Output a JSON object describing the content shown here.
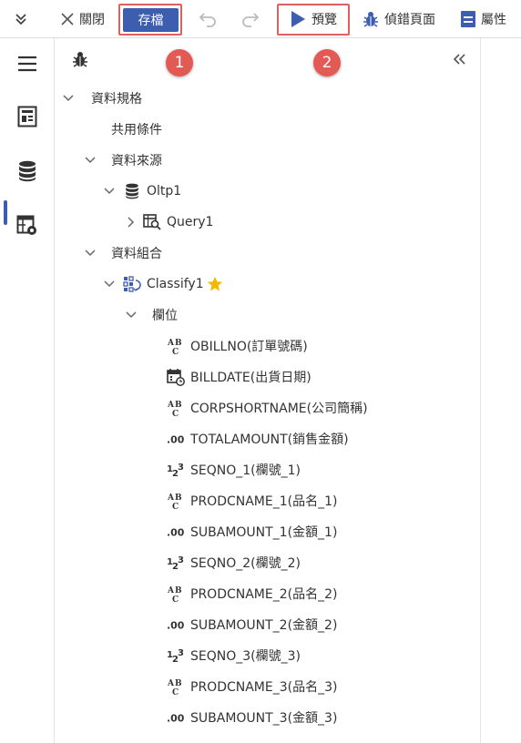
{
  "toolbar": {
    "expand_icon": "double-chevron-down-icon",
    "close_label": "關閉",
    "save_label": "存檔",
    "undo_icon": "undo-icon",
    "redo_icon": "redo-icon",
    "preview_label": "預覽",
    "debug_label": "偵錯頁面",
    "properties_label": "屬性"
  },
  "annotations": {
    "step1": "1",
    "step2": "2"
  },
  "colors": {
    "accent": "#3d5db0",
    "highlight": "#e06060",
    "star": "#f5b800"
  },
  "rail": {
    "items": [
      {
        "icon": "menu-icon"
      },
      {
        "icon": "page-layout-icon"
      },
      {
        "icon": "database-icon",
        "active": true
      },
      {
        "icon": "settings-table-icon"
      }
    ]
  },
  "panel": {
    "collapse_icon": "double-chevron-left-icon",
    "bug_icon": "bug-icon"
  },
  "tree": {
    "data_spec": "資料規格",
    "common_conditions": "共用條件",
    "data_source": "資料來源",
    "oltp": "Oltp1",
    "query": "Query1",
    "data_combination": "資料組合",
    "classify": "Classify1",
    "fields_group": "欄位",
    "fields": [
      {
        "type": "text",
        "label": "OBILLNO(訂單號碼)"
      },
      {
        "type": "date",
        "label": "BILLDATE(出貨日期)"
      },
      {
        "type": "text",
        "label": "CORPSHORTNAME(公司簡稱)"
      },
      {
        "type": "decimal",
        "label": "TOTALAMOUNT(銷售金額)"
      },
      {
        "type": "integer",
        "label": "SEQNO_1(欄號_1)"
      },
      {
        "type": "text",
        "label": "PRODCNAME_1(品名_1)"
      },
      {
        "type": "decimal",
        "label": "SUBAMOUNT_1(金額_1)"
      },
      {
        "type": "integer",
        "label": "SEQNO_2(欄號_2)"
      },
      {
        "type": "text",
        "label": "PRODCNAME_2(品名_2)"
      },
      {
        "type": "decimal",
        "label": "SUBAMOUNT_2(金額_2)"
      },
      {
        "type": "integer",
        "label": "SEQNO_3(欄號_3)"
      },
      {
        "type": "text",
        "label": "PRODCNAME_3(品名_3)"
      },
      {
        "type": "decimal",
        "label": "SUBAMOUNT_3(金額_3)"
      }
    ]
  }
}
